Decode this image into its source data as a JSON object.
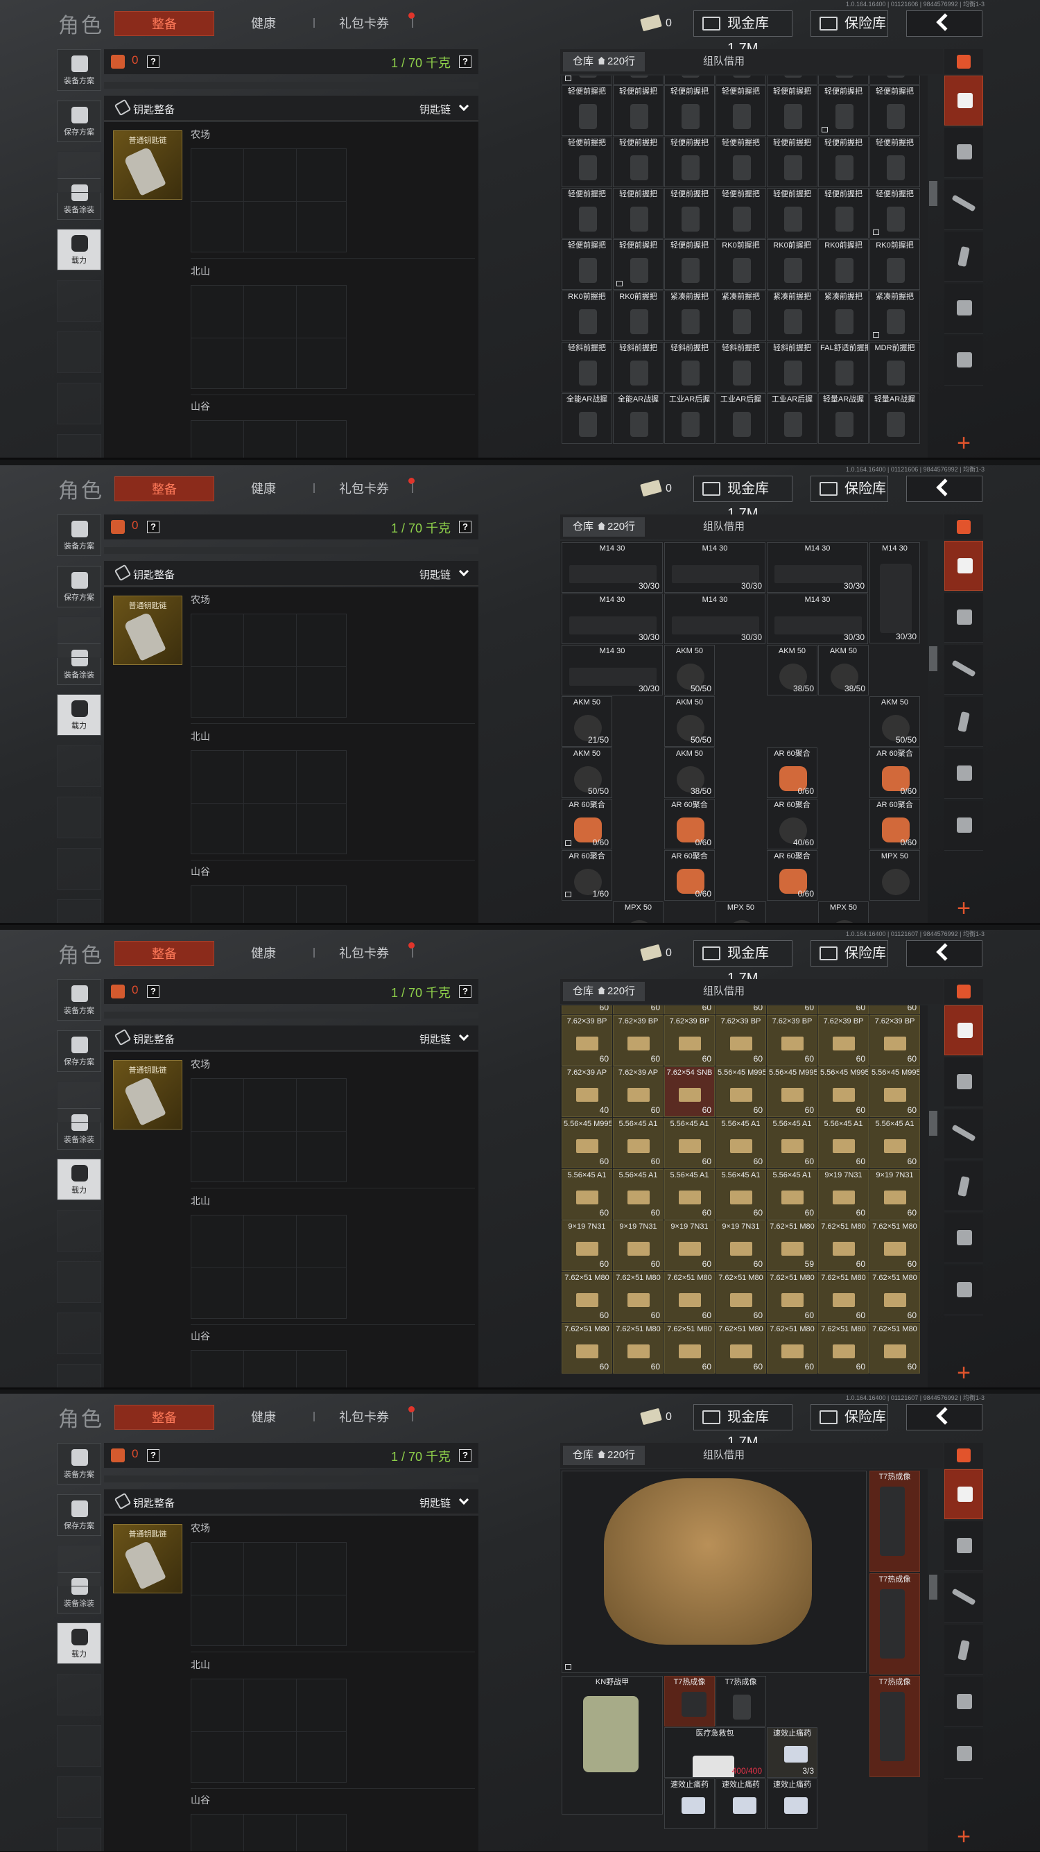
{
  "header": {
    "title": "角色",
    "tabs": [
      "整备",
      "健康",
      "礼包卡券"
    ],
    "cash_count": "0",
    "cash_vault": "现金库 1.7M",
    "safe_box": "保险库"
  },
  "versions": [
    "1.0.164.16400 | 01121606 | 9844576992 | 均衡1-3",
    "1.0.164.16400 | 01121606 | 9844576992 | 均衡1-3",
    "1.0.164.16400 | 01121607 | 9844576992 | 均衡1-3",
    "1.0.164.16400 | 01121607 | 9844576992 | 均衡1-3"
  ],
  "sidebar": {
    "items": [
      "装备方案",
      "保存方案",
      "装备涂装",
      "载力"
    ]
  },
  "loadout": {
    "rig_count": "0",
    "weight": "1 / 70 千克",
    "key_label": "钥匙整备",
    "chain_label": "钥匙链",
    "key_item": "普通钥匙链",
    "maps": [
      "农场",
      "北山",
      "山谷"
    ]
  },
  "storage": {
    "tab_warehouse": "仓库",
    "rows": "220行",
    "tab_team": "组队借用"
  },
  "grid1": {
    "cells": [
      [
        "轻便前握把",
        "轻便前握把",
        "轻便前握把",
        "轻便前握把",
        "轻便前握把",
        "轻便前握把",
        "轻便前握把"
      ],
      [
        "轻便前握把",
        "轻便前握把",
        "轻便前握把",
        "轻便前握把",
        "轻便前握把",
        "轻便前握把",
        "轻便前握把"
      ],
      [
        "轻便前握把",
        "轻便前握把",
        "轻便前握把",
        "轻便前握把",
        "轻便前握把",
        "轻便前握把",
        "轻便前握把"
      ],
      [
        "轻便前握把",
        "轻便前握把",
        "轻便前握把",
        "RK0前握把",
        "RK0前握把",
        "RK0前握把",
        "RK0前握把"
      ],
      [
        "RK0前握把",
        "RK0前握把",
        "紧凑前握把",
        "紧凑前握把",
        "紧凑前握把",
        "紧凑前握把",
        "紧凑前握把"
      ],
      [
        "轻斜前握把",
        "轻斜前握把",
        "轻斜前握把",
        "轻斜前握把",
        "轻斜前握把",
        "FAL舒适前握把",
        "MDR前握把"
      ],
      [
        "全能AR战握",
        "全能AR战握",
        "工业AR后握",
        "工业AR后握",
        "工业AR后握",
        "轻量AR战握",
        "轻量AR战握"
      ]
    ]
  },
  "grid2": {
    "m14": "M14 30",
    "m14_count": "30/30",
    "akm": "AKM 50",
    "akm_counts": [
      "50/50",
      "38/50",
      "50/50",
      "21/50",
      "50/50",
      "50/50",
      "50/50",
      "38/50"
    ],
    "ar": "AR 60聚合",
    "ar_counts": [
      "0/60",
      "0/60",
      "0/60",
      "0/60",
      "40/60",
      "0/60",
      "1/60",
      "0/60",
      "0/60"
    ],
    "mpx": "MPX 50"
  },
  "grid3": {
    "rows": [
      [
        [
          "7.62×39 BP",
          "60"
        ],
        [
          "7.62×39 BP",
          "60"
        ],
        [
          "7.62×39 BP",
          "60"
        ],
        [
          "7.62×39 BP",
          "60"
        ],
        [
          "7.62×39 BP",
          "60"
        ],
        [
          "7.62×39 BP",
          "60"
        ],
        [
          "7.62×39 BP",
          "60"
        ]
      ],
      [
        [
          "7.62×39 BP",
          "60"
        ],
        [
          "7.62×39 BP",
          "60"
        ],
        [
          "7.62×39 BP",
          "60"
        ],
        [
          "7.62×39 BP",
          "60"
        ],
        [
          "7.62×39 BP",
          "60"
        ],
        [
          "7.62×39 BP",
          "60"
        ],
        [
          "7.62×39 BP",
          "60"
        ]
      ],
      [
        [
          "7.62×39 AP",
          "40"
        ],
        [
          "7.62×39 AP",
          "60"
        ],
        [
          "7.62×54 SNB",
          "60"
        ],
        [
          "5.56×45 M995",
          "60"
        ],
        [
          "5.56×45 M995",
          "60"
        ],
        [
          "5.56×45 M995",
          "60"
        ],
        [
          "5.56×45 M995",
          "60"
        ]
      ],
      [
        [
          "5.56×45 M995",
          "60"
        ],
        [
          "5.56×45 A1",
          "60"
        ],
        [
          "5.56×45 A1",
          "60"
        ],
        [
          "5.56×45 A1",
          "60"
        ],
        [
          "5.56×45 A1",
          "60"
        ],
        [
          "5.56×45 A1",
          "60"
        ],
        [
          "5.56×45 A1",
          "60"
        ]
      ],
      [
        [
          "5.56×45 A1",
          "60"
        ],
        [
          "5.56×45 A1",
          "60"
        ],
        [
          "5.56×45 A1",
          "60"
        ],
        [
          "5.56×45 A1",
          "60"
        ],
        [
          "5.56×45 A1",
          "60"
        ],
        [
          "9×19 7N31",
          "60"
        ],
        [
          "9×19 7N31",
          "60"
        ]
      ],
      [
        [
          "9×19 7N31",
          "60"
        ],
        [
          "9×19 7N31",
          "60"
        ],
        [
          "9×19 7N31",
          "60"
        ],
        [
          "9×19 7N31",
          "60"
        ],
        [
          "7.62×51 M80",
          "59"
        ],
        [
          "7.62×51 M80",
          "60"
        ],
        [
          "7.62×51 M80",
          "60"
        ]
      ],
      [
        [
          "7.62×51 M80",
          "60"
        ],
        [
          "7.62×51 M80",
          "60"
        ],
        [
          "7.62×51 M80",
          "60"
        ],
        [
          "7.62×51 M80",
          "60"
        ],
        [
          "7.62×51 M80",
          "60"
        ],
        [
          "7.62×51 M80",
          "60"
        ],
        [
          "7.62×51 M80",
          "60"
        ]
      ],
      [
        [
          "7.62×51 M80",
          "60"
        ],
        [
          "7.62×51 M80",
          "60"
        ],
        [
          "7.62×51 M80",
          "60"
        ],
        [
          "7.62×51 M80",
          "60"
        ],
        [
          "7.62×51 M80",
          "60"
        ],
        [
          "7.62×51 M80",
          "60"
        ],
        [
          "7.62×51 M80",
          "60"
        ]
      ]
    ]
  },
  "grid4": {
    "bag": "KN野战甲",
    "thermal": "T7热成像",
    "medkit_count": "400/400",
    "medkit_name": "医疗急救包",
    "bandage": "速效止痛药",
    "bandage_count": "3/3"
  }
}
